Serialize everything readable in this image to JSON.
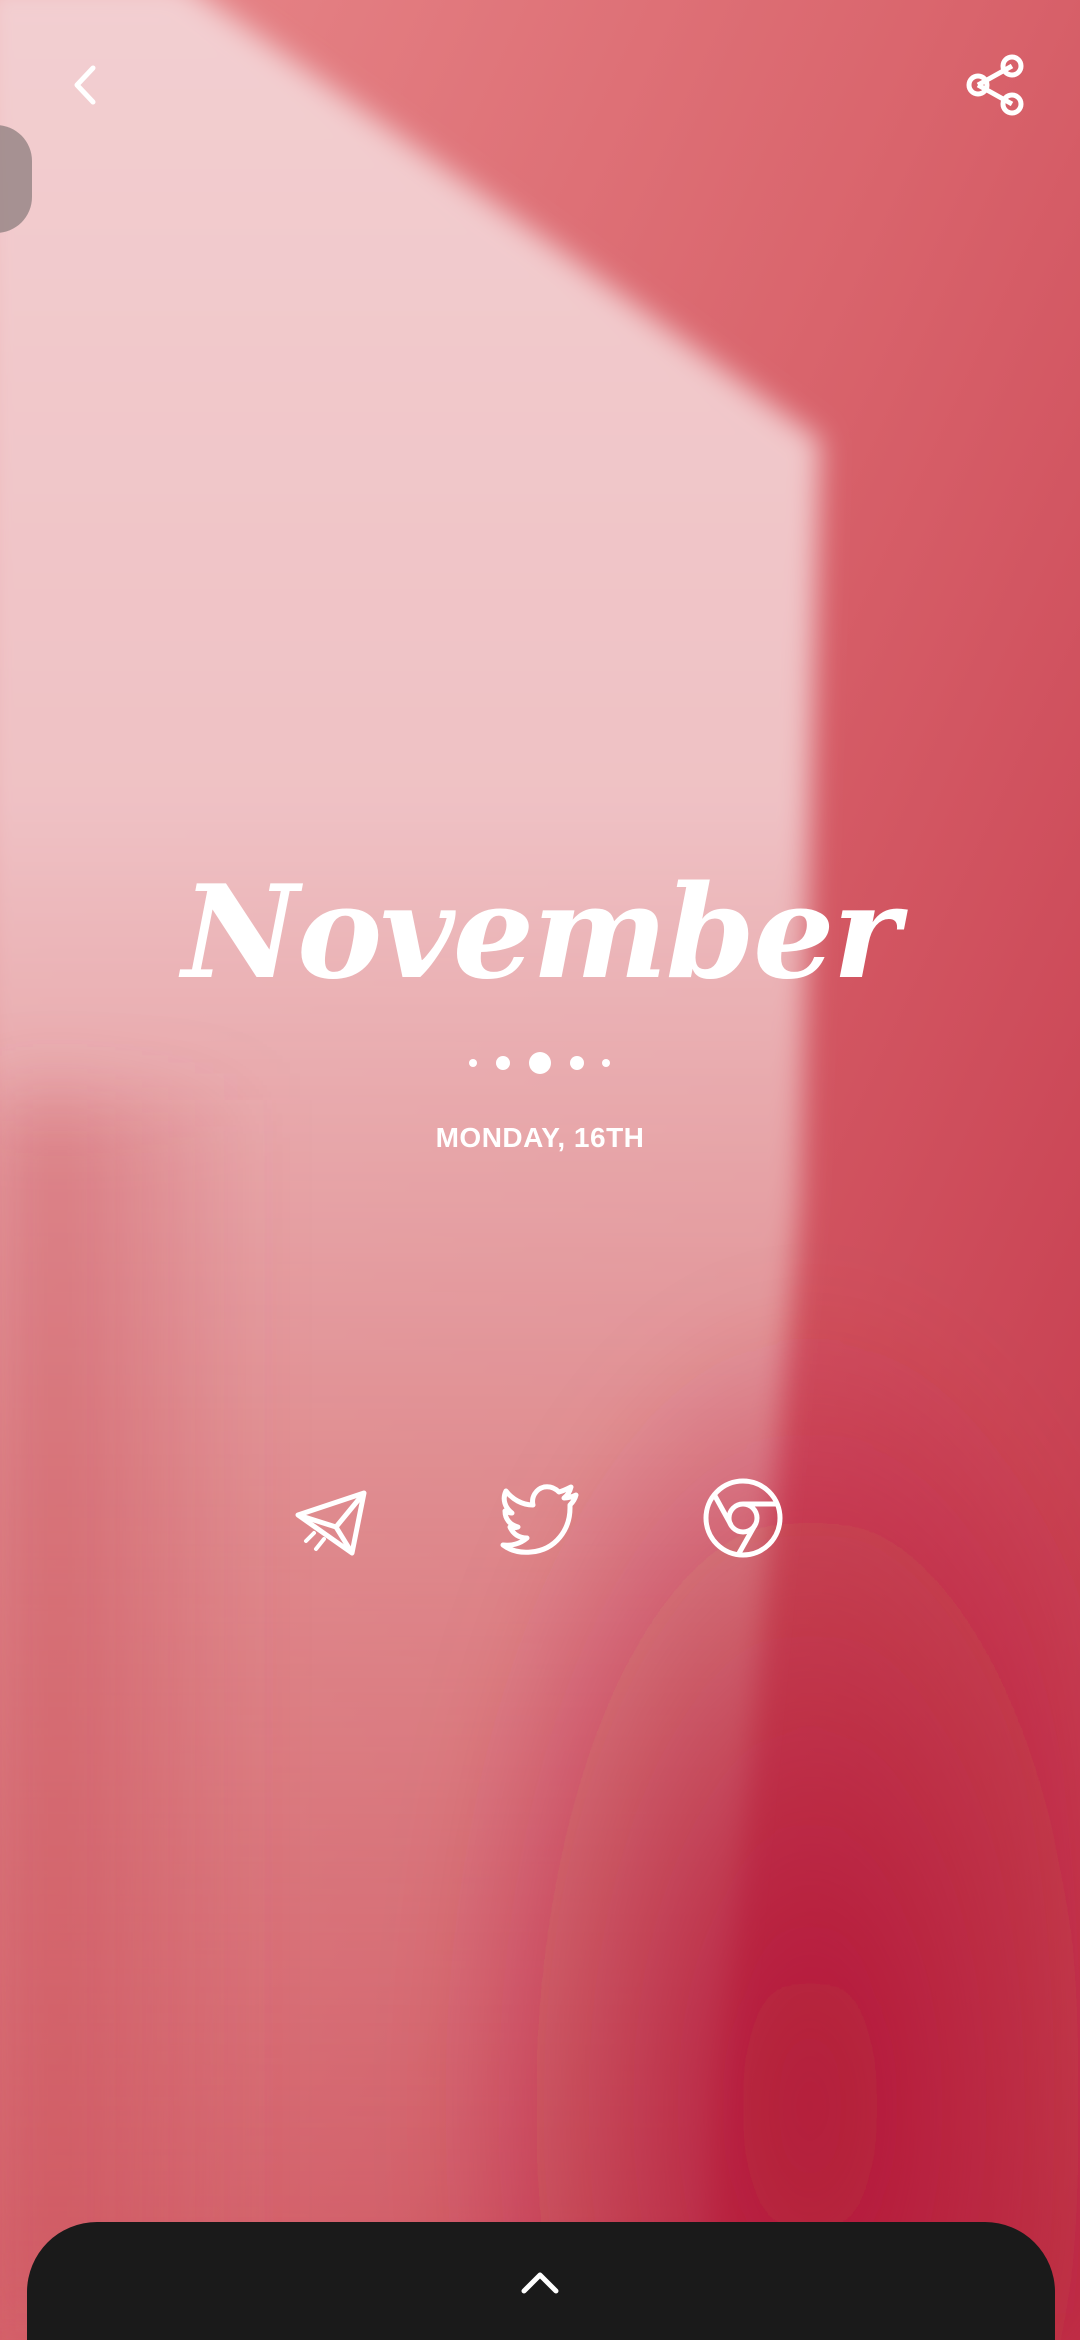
{
  "home": {
    "month": "November",
    "date": "MONDAY, 16TH"
  },
  "icons": {
    "back": "chevron-left-icon",
    "share": "share-icon",
    "apps": [
      "telegram-icon",
      "twitter-icon",
      "chrome-icon"
    ],
    "dock_toggle": "chevron-up-icon"
  },
  "colors": {
    "background": "#d9606a",
    "light_panel": "#f1c6c9",
    "deep_red": "#b71a33",
    "text": "#ffffff",
    "dock": "#1a1a1a"
  }
}
